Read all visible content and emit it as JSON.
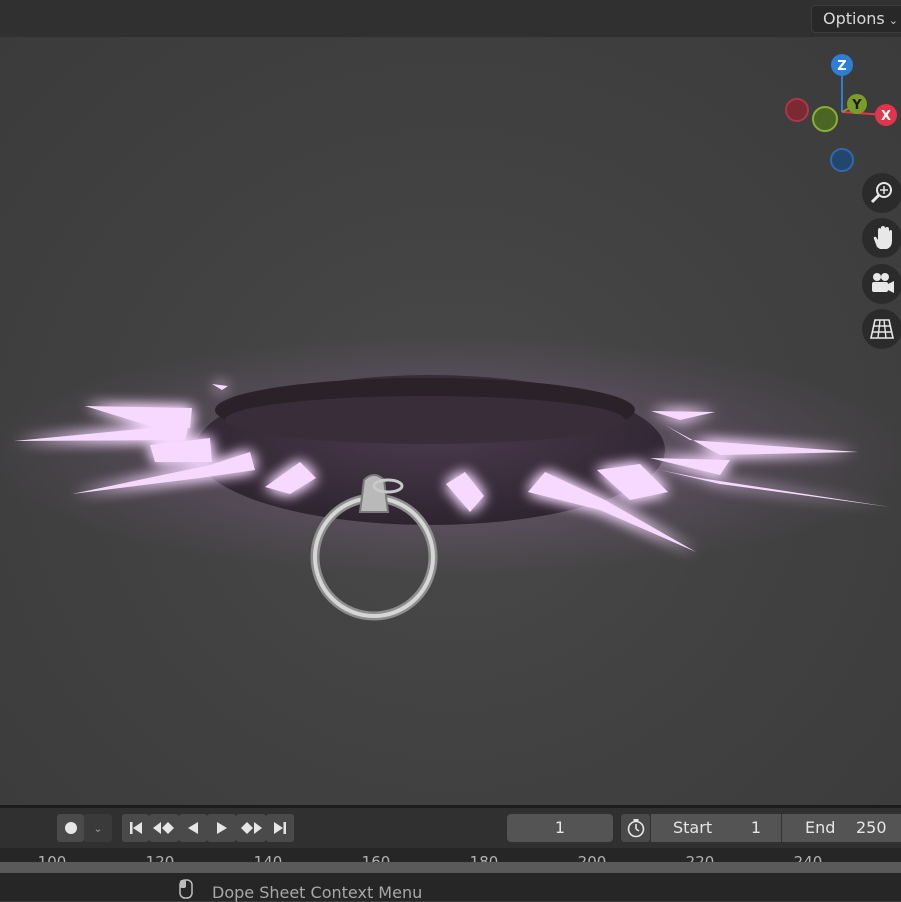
{
  "header": {
    "options_label": "Options"
  },
  "gizmo": {
    "axis_z": "Z",
    "axis_y": "Y",
    "axis_x": "X",
    "colors": {
      "x": "#e0354a",
      "y": "#7a9d2a",
      "z": "#2d7fd6"
    }
  },
  "nav_icons": [
    "zoom-icon",
    "hand-pan-icon",
    "camera-icon",
    "grid-icon"
  ],
  "timeline": {
    "current_frame": "1",
    "start_label": "Start",
    "start_value": "1",
    "end_label": "End",
    "end_value": "250",
    "ruler_ticks": [
      "100",
      "120",
      "140",
      "160",
      "180",
      "200",
      "220",
      "240"
    ]
  },
  "status": {
    "context_menu_label": "Dope Sheet Context Menu"
  },
  "colors": {
    "glow": "#f4c8ff",
    "collar": "#3a2e3c",
    "ring": "#c8c8c8"
  }
}
